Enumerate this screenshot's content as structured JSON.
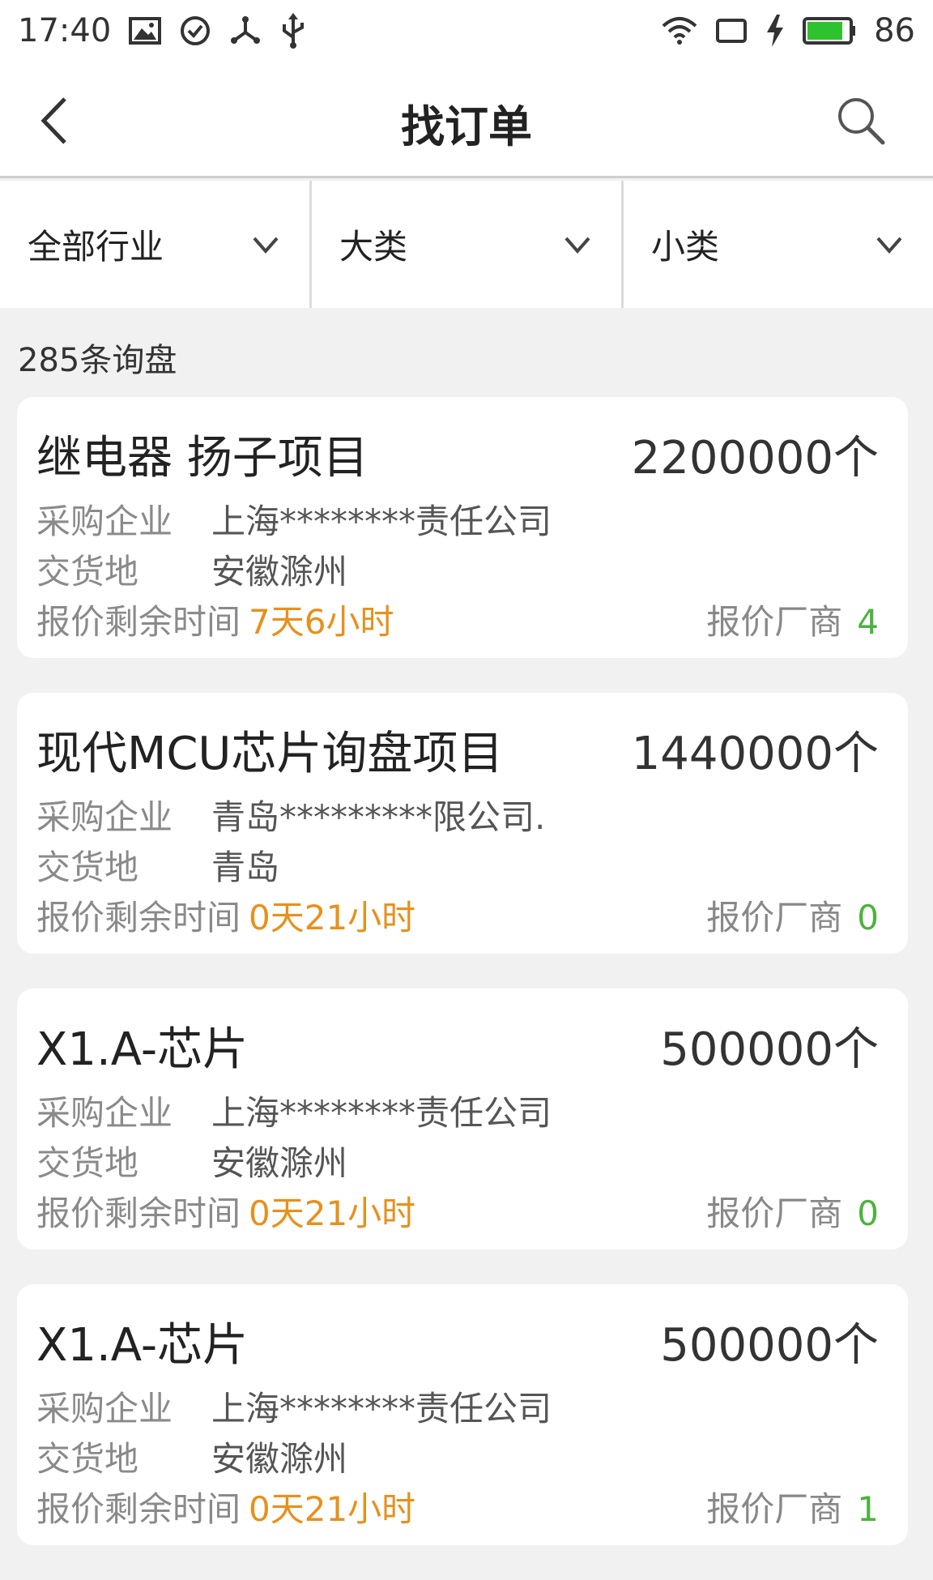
{
  "status_bar": {
    "time": "17:40",
    "battery": "86",
    "left_icons": [
      "image-icon",
      "check-circle-icon",
      "share-node-icon",
      "usb-icon"
    ],
    "right_icons": [
      "wifi-icon",
      "screen-icon",
      "charging-icon",
      "battery-icon"
    ],
    "battery_color": "#2ec22e"
  },
  "header": {
    "title": "找订单"
  },
  "filters": [
    {
      "label": "全部行业"
    },
    {
      "label": "大类"
    },
    {
      "label": "小类"
    }
  ],
  "count_text": "285条询盘",
  "labels": {
    "company": "采购企业",
    "delivery": "交货地",
    "remaining": "报价剩余时间",
    "vendors": "报价厂商"
  },
  "cards": [
    {
      "name": "继电器 扬子项目",
      "quantity": "2200000个",
      "company": "上海********责任公司",
      "delivery": "安徽滁州",
      "remaining": "7天6小时",
      "vendors": "4"
    },
    {
      "name": "现代MCU芯片询盘项目",
      "quantity": "1440000个",
      "company": "青岛*********限公司.",
      "delivery": "青岛",
      "remaining": "0天21小时",
      "vendors": "0"
    },
    {
      "name": "X1.A-芯片",
      "quantity": "500000个",
      "company": "上海********责任公司",
      "delivery": "安徽滁州",
      "remaining": "0天21小时",
      "vendors": "0"
    },
    {
      "name": "X1.A-芯片",
      "quantity": "500000个",
      "company": "上海********责任公司",
      "delivery": "安徽滁州",
      "remaining": "0天21小时",
      "vendors": "1"
    }
  ],
  "colors": {
    "accent_orange": "#e8901b",
    "accent_green": "#4bb33d",
    "background": "#f1f1f1"
  }
}
